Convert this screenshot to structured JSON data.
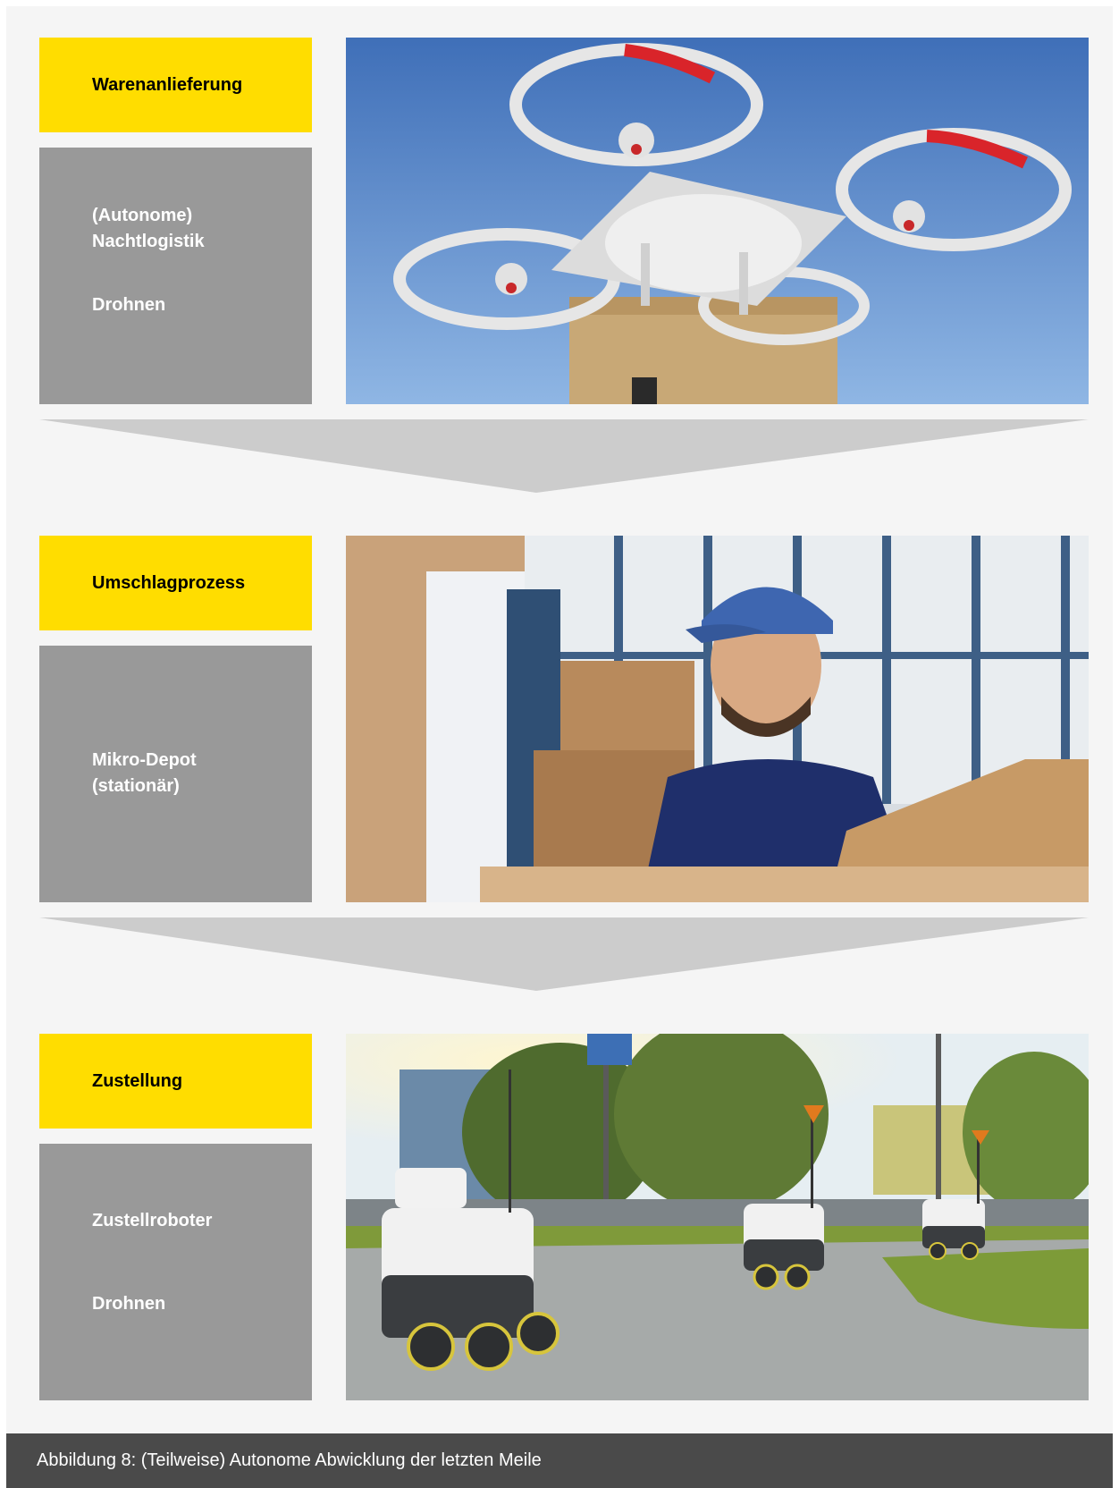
{
  "stages": [
    {
      "stage": "Warenanlieferung",
      "items": [
        "(Autonome)\nNachtlogistik",
        "Drohnen"
      ],
      "photo": "drone-carrying-parcel"
    },
    {
      "stage": "Umschlagprozess",
      "items": [
        "Mikro-Depot\n(stationär)"
      ],
      "photo": "worker-in-warehouse"
    },
    {
      "stage": "Zustellung",
      "items": [
        "Zustellroboter",
        "Drohnen"
      ],
      "photo": "delivery-robots-on-street"
    }
  ],
  "caption": "Abbildung 8: (Teilweise) Autonome Abwicklung der letzten Meile",
  "colors": {
    "stage_box": "#ffdd00",
    "item_box": "#999999",
    "arrow": "#cccccc",
    "caption_bar": "#4a4a4a",
    "background": "#f5f5f5"
  }
}
